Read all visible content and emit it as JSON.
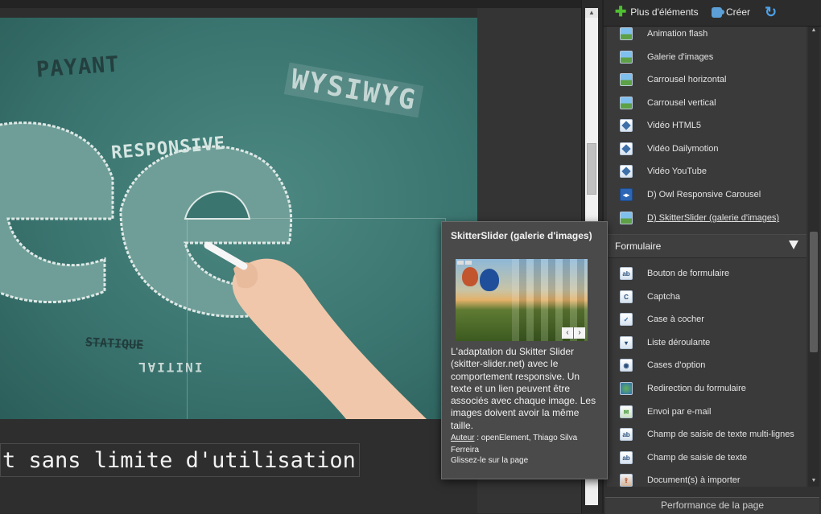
{
  "canvas": {
    "hero_words": {
      "payant": "PAYANT",
      "wysiwyg": "WYSIWYG",
      "responsive": "RESPONSIVE",
      "statique": "STATIQUE",
      "initial": "INITIAL"
    },
    "caption": "t sans limite d'utilisation"
  },
  "toolbar": {
    "more_label": "Plus d'éléments",
    "create_label": "Créer"
  },
  "elements_list": {
    "items": [
      {
        "label": "Animation flash",
        "icon": "flash-animation-icon"
      },
      {
        "label": "Galerie d'images",
        "icon": "image-gallery-icon"
      },
      {
        "label": "Carrousel horizontal",
        "icon": "horizontal-carousel-icon"
      },
      {
        "label": "Carrousel vertical",
        "icon": "vertical-carousel-icon"
      },
      {
        "label": "Vidéo HTML5",
        "icon": "html5-video-icon"
      },
      {
        "label": "Vidéo Dailymotion",
        "icon": "dailymotion-video-icon"
      },
      {
        "label": "Vidéo YouTube",
        "icon": "youtube-video-icon"
      },
      {
        "label": "D) Owl Responsive Carousel",
        "icon": "owl-carousel-icon"
      },
      {
        "label": "D) SkitterSlider (galerie d'images)",
        "icon": "skitter-slider-icon"
      }
    ],
    "section_form": "Formulaire",
    "form_items": [
      {
        "label": "Bouton de formulaire",
        "icon": "form-button-icon",
        "glyph": "ab"
      },
      {
        "label": "Captcha",
        "icon": "captcha-icon",
        "glyph": "C"
      },
      {
        "label": "Case à cocher",
        "icon": "checkbox-icon",
        "glyph": "✓"
      },
      {
        "label": "Liste déroulante",
        "icon": "dropdown-list-icon",
        "glyph": "▾"
      },
      {
        "label": "Cases d'option",
        "icon": "radio-options-icon",
        "glyph": "◉"
      },
      {
        "label": "Redirection du formulaire",
        "icon": "form-redirect-icon",
        "glyph": ""
      },
      {
        "label": "Envoi par e-mail",
        "icon": "email-send-icon",
        "glyph": "✉"
      },
      {
        "label": "Champ de saisie de texte multi-lignes",
        "icon": "multiline-text-field-icon",
        "glyph": "ab"
      },
      {
        "label": "Champ de saisie de texte",
        "icon": "text-field-icon",
        "glyph": "ab"
      },
      {
        "label": "Document(s) à importer",
        "icon": "file-import-icon",
        "glyph": "⇪"
      }
    ]
  },
  "footer": {
    "performance_label": "Performance de la page"
  },
  "tooltip": {
    "title": "SkitterSlider (galerie d'images)",
    "description": "L'adaptation du Skitter Slider (skitter-slider.net) avec le comportement responsive. Un texte et un lien peuvent être associés avec chaque image. Les images doivent avoir la même taille.",
    "author_key": "Auteur",
    "author_value": " : openElement, Thiago Silva Ferreira",
    "drag_hint": "Glissez-le sur la page",
    "nav_prev": "‹",
    "nav_next": "›"
  },
  "colors": {
    "accent_green": "#4ec02f",
    "accent_blue": "#4ea1e8",
    "chalkboard": "#3b7570"
  }
}
